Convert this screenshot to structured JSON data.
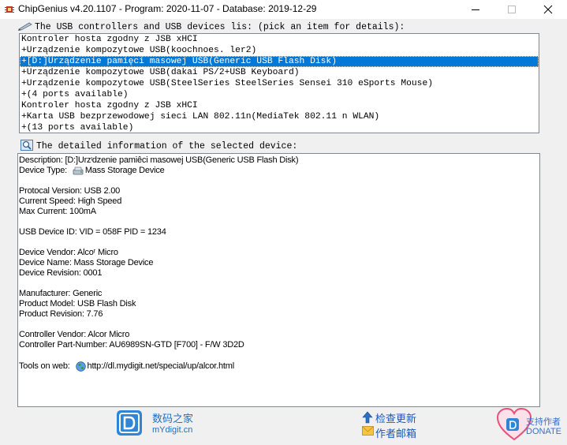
{
  "window": {
    "title": "ChipGenius v4.20.1107 - Program: 2020-11-07 - Database: 2019-12-29"
  },
  "devices_section": {
    "label": "The USB controllers and USB devices lis: (pick an item for details):",
    "items": [
      "Kontroler hosta zgodny z JSB xHCI",
      "+Urządzenie kompozytowe USB(koochnoes. ler2)",
      "+[D:]Urządzenie pamięci masowej USB(Generic USB Flash Disk)",
      "+Urządzenie kompozytowe USB(dakai PS/2+USB Keyboard)",
      "+Urządzenie kompozytowe USB(SteelSeries SteelSeries Sensei 310 eSports Mouse)",
      "+(4 ports available)",
      "Kontroler hosta zgodny z JSB xHCI",
      "+Karta USB bezprzewodowej sieci LAN 802.11n(MediaTek 802.11 n WLAN)",
      "+(13 ports available)"
    ],
    "selected_index": 2
  },
  "details_section": {
    "label": "The detailed information of the selected device:",
    "description": "Description: [D:]Urzᶦdzenie pamiêci masowej USB(Generic USB Flash Disk)",
    "device_type_label": "Device Type:",
    "device_type_value": "Mass Storage Device",
    "protocol": "Protocal Version: USB 2.00",
    "speed": "Current Speed: High Speed",
    "max_current": "Max Current: 100mA",
    "device_id": "USB Device ID: VID = 058F PID = 1234",
    "vendor": "Device Vendor: Alcoʳ Micro",
    "name": "Device Name: Mass Storage Device",
    "revision": "Device Revision: 0001",
    "manufacturer": "Manufacturer: Generic",
    "product_model": "Product Model: USB Flash Disk",
    "product_revision": "Product Revision: 7.76",
    "controller_vendor": "Controller Vendor: Alcor Micro",
    "controller_part": "Controller Part-Number: AU6989SN-GTD [F700] - F/W 3D2D",
    "tools_label": "Tools on web:",
    "tools_url": "http://dl.mydigit.net/special/up/alcor.html"
  },
  "footer": {
    "site_name": "数码之家",
    "site_url": "mYdigit.cn",
    "check_update": "检查更新",
    "email_author": "作者邮箱",
    "support_author": "支持作者",
    "donate": "DONATE"
  },
  "colors": {
    "selection": "#0078d7",
    "link": "#1f55b5",
    "logo_blue": "#1a6fc2"
  },
  "icons": {
    "app": "chip-icon",
    "devices_section": "pen-icon",
    "details_section": "magnifier-icon",
    "device_type": "drive-icon",
    "tools": "globe-icon",
    "update": "up-arrow-icon",
    "email": "envelope-icon",
    "donate": "heart-icon"
  }
}
